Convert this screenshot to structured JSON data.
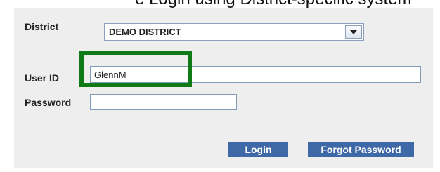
{
  "caption_fragment": "e Login using District-specific system",
  "form": {
    "district": {
      "label": "District",
      "selected": "DEMO DISTRICT"
    },
    "user_id": {
      "label": "User ID",
      "value": "GlennM"
    },
    "password": {
      "label": "Password",
      "value": ""
    }
  },
  "buttons": {
    "login": "Login",
    "forgot_password": "Forgot Password"
  },
  "colors": {
    "panel_bg": "#eeeeee",
    "button_bg": "#3f68a6",
    "highlight": "#0f7a16"
  },
  "icons": {
    "dropdown": "chevron-down-icon"
  }
}
